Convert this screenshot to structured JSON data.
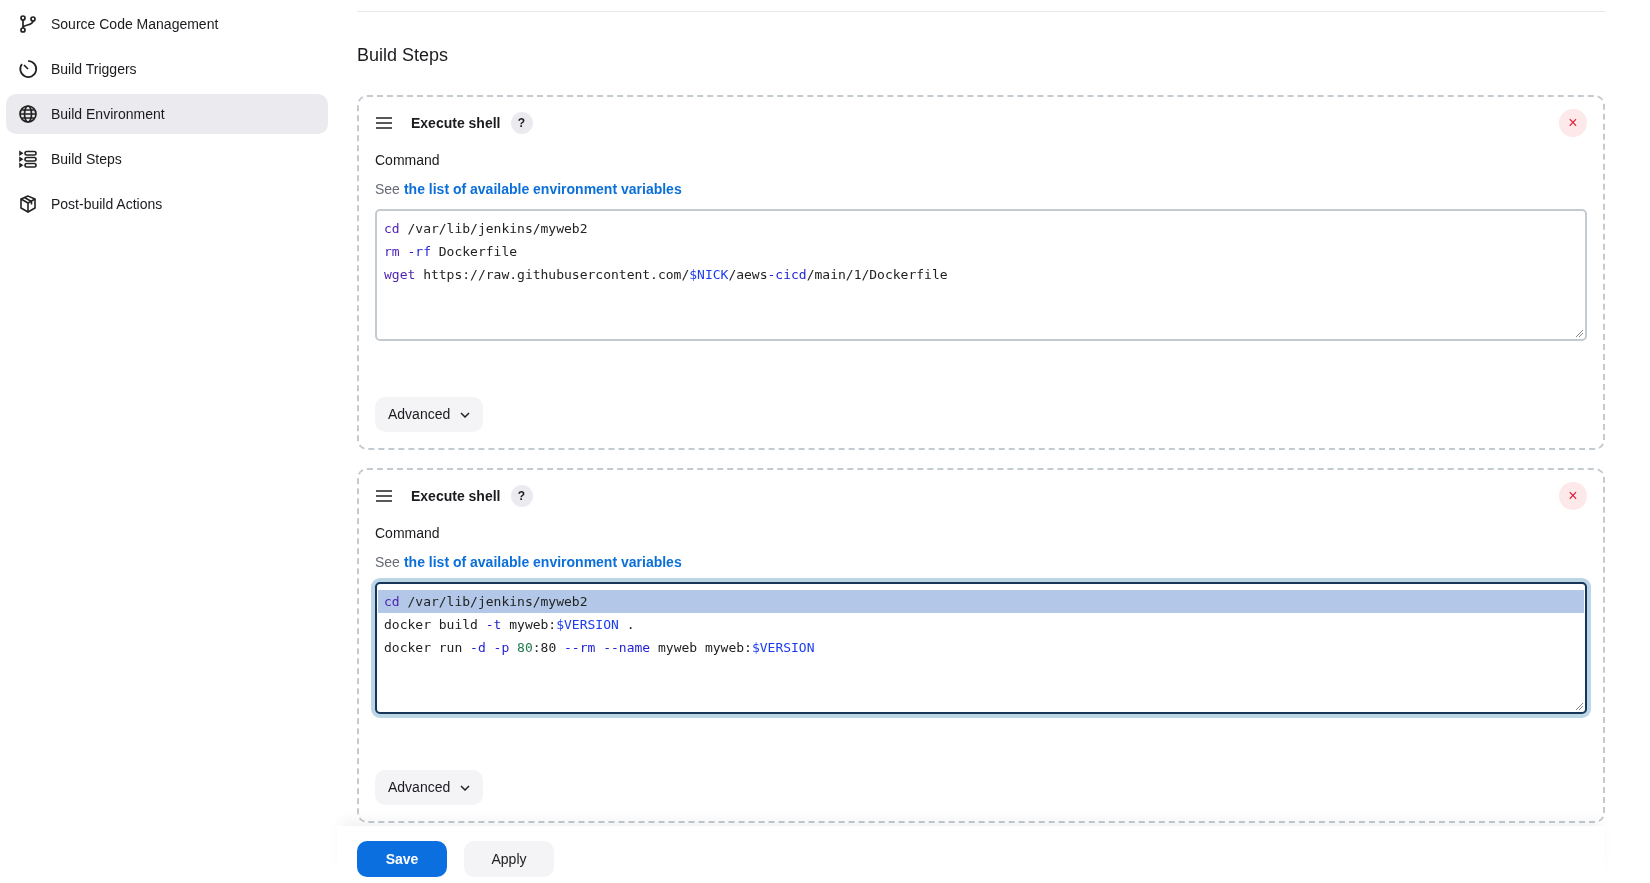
{
  "sidebar": {
    "items": [
      {
        "label": "Source Code Management",
        "selected": false
      },
      {
        "label": "Build Triggers",
        "selected": false
      },
      {
        "label": "Build Environment",
        "selected": true
      },
      {
        "label": "Build Steps",
        "selected": false
      },
      {
        "label": "Post-build Actions",
        "selected": false
      }
    ]
  },
  "section_title": "Build Steps",
  "steps": [
    {
      "title": "Execute shell",
      "help": "?",
      "close": "×",
      "field_label": "Command",
      "hint_prefix": "See",
      "hint_link": "the list of available environment variables",
      "focused": false,
      "lines": [
        {
          "selected": false,
          "tokens": [
            {
              "kind": "keyword",
              "text": "cd"
            },
            {
              "kind": "plain",
              "text": " /var/lib/jenkins/myweb2"
            }
          ]
        },
        {
          "selected": false,
          "tokens": [
            {
              "kind": "keyword",
              "text": "rm"
            },
            {
              "kind": "flag",
              "text": " -rf"
            },
            {
              "kind": "plain",
              "text": " Dockerfile"
            }
          ]
        },
        {
          "selected": false,
          "tokens": [
            {
              "kind": "keyword",
              "text": "wget"
            },
            {
              "kind": "plain",
              "text": " https://raw.githubusercontent.com/"
            },
            {
              "kind": "variable",
              "text": "$NICK"
            },
            {
              "kind": "plain",
              "text": "/aews"
            },
            {
              "kind": "flag",
              "text": "-cicd"
            },
            {
              "kind": "plain",
              "text": "/main/1/Dockerfile"
            }
          ]
        }
      ],
      "advanced": "Advanced"
    },
    {
      "title": "Execute shell",
      "help": "?",
      "close": "×",
      "field_label": "Command",
      "hint_prefix": "See",
      "hint_link": "the list of available environment variables",
      "focused": true,
      "lines": [
        {
          "selected": true,
          "tokens": [
            {
              "kind": "keyword",
              "text": "cd"
            },
            {
              "kind": "plain",
              "text": " /var/lib/jenkins/myweb2"
            }
          ]
        },
        {
          "selected": false,
          "tokens": [
            {
              "kind": "plain",
              "text": "docker build"
            },
            {
              "kind": "flag",
              "text": " -t"
            },
            {
              "kind": "plain",
              "text": " myweb:"
            },
            {
              "kind": "variable",
              "text": "$VERSION"
            },
            {
              "kind": "plain",
              "text": " ."
            }
          ]
        },
        {
          "selected": false,
          "tokens": [
            {
              "kind": "plain",
              "text": "docker run"
            },
            {
              "kind": "flag",
              "text": " -d"
            },
            {
              "kind": "flag",
              "text": " -p"
            },
            {
              "kind": "number",
              "text": " 80"
            },
            {
              "kind": "plain",
              "text": ":80"
            },
            {
              "kind": "flag",
              "text": " --rm"
            },
            {
              "kind": "flag",
              "text": " --name"
            },
            {
              "kind": "plain",
              "text": " myweb myweb:"
            },
            {
              "kind": "variable",
              "text": "$VERSION"
            }
          ]
        }
      ],
      "advanced": "Advanced"
    }
  ],
  "buttons": [
    {
      "label": "Save",
      "kind": "primary"
    },
    {
      "label": "Apply",
      "kind": "secondary"
    }
  ]
}
